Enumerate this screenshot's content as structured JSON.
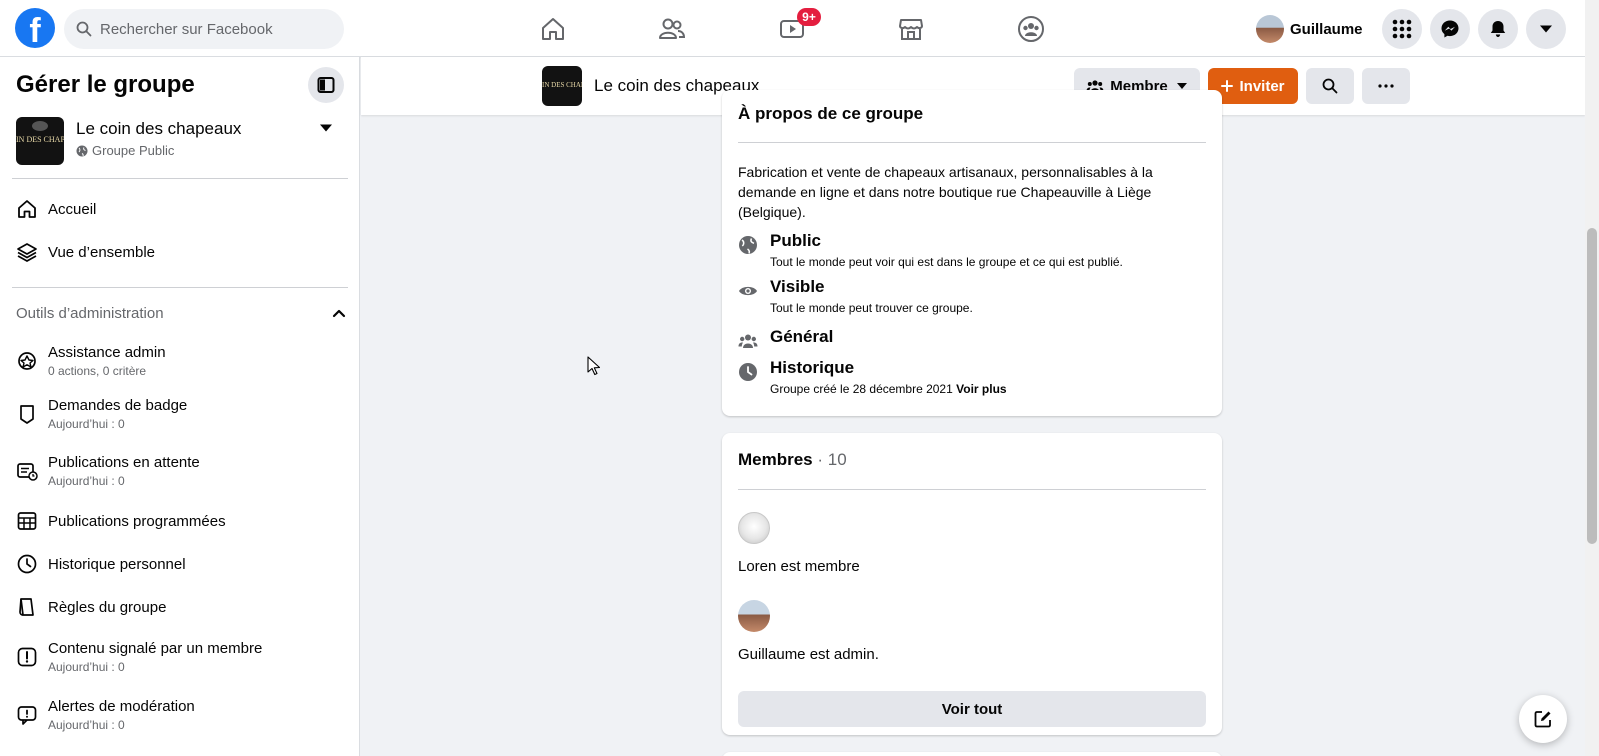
{
  "topbar": {
    "logo": "f",
    "search_placeholder": "Rechercher sur Facebook",
    "nav_icons": [
      "home-icon",
      "friends-icon",
      "watch-icon",
      "marketplace-icon",
      "groups-icon"
    ],
    "watch_badge": "9+",
    "profile_name": "Guillaume",
    "right_icons": [
      "menu-grid-icon",
      "messenger-icon",
      "notifications-icon",
      "account-caret-icon"
    ]
  },
  "sidebar": {
    "title": "Gérer le groupe",
    "group_name": "Le coin des chapeaux",
    "group_type": "Groupe Public",
    "group_thumb_text": "IN DES CHAP",
    "nav": [
      {
        "label": "Accueil",
        "icon": "home-icon"
      },
      {
        "label": "Vue d’ensemble",
        "icon": "layers-icon"
      }
    ],
    "admin_section_title": "Outils d’administration",
    "admin_items": [
      {
        "label": "Assistance admin",
        "sub": "0 actions, 0 critère"
      },
      {
        "label": "Demandes de badge",
        "sub": "Aujourd’hui : 0"
      },
      {
        "label": "Publications en attente",
        "sub": "Aujourd’hui : 0"
      },
      {
        "label": "Publications programmées",
        "sub": ""
      },
      {
        "label": "Historique personnel",
        "sub": ""
      },
      {
        "label": "Règles du groupe",
        "sub": ""
      },
      {
        "label": "Contenu signalé par un membre",
        "sub": "Aujourd’hui : 0"
      },
      {
        "label": "Alertes de modération",
        "sub": "Aujourd’hui : 0"
      }
    ]
  },
  "group_bar": {
    "title": "Le coin des chapeaux",
    "thumb_text": "IN DES CHAP",
    "member_button": "Membre",
    "invite_button": "Inviter"
  },
  "about": {
    "header": "À propos de ce groupe",
    "description": "Fabrication et vente de chapeaux artisanaux, personnalisables à la demande en ligne et dans notre boutique rue Chapeauville à Liège (Belgique).",
    "rows": [
      {
        "title": "Public",
        "sub": "Tout le monde peut voir qui est dans le groupe et ce qui est publié."
      },
      {
        "title": "Visible",
        "sub": "Tout le monde peut trouver ce groupe."
      },
      {
        "title": "Général",
        "sub": ""
      },
      {
        "title": "Historique",
        "sub": "Groupe créé le 28 décembre 2021",
        "link": "Voir plus"
      }
    ]
  },
  "members": {
    "title": "Membres",
    "count": "· 10",
    "entries": [
      {
        "text": "Loren est membre"
      },
      {
        "text": "Guillaume est admin."
      }
    ],
    "see_all": "Voir tout"
  },
  "colors": {
    "brand_blue": "#1877f2",
    "invite_orange": "#e05e10",
    "badge_red": "#e41e3f"
  }
}
